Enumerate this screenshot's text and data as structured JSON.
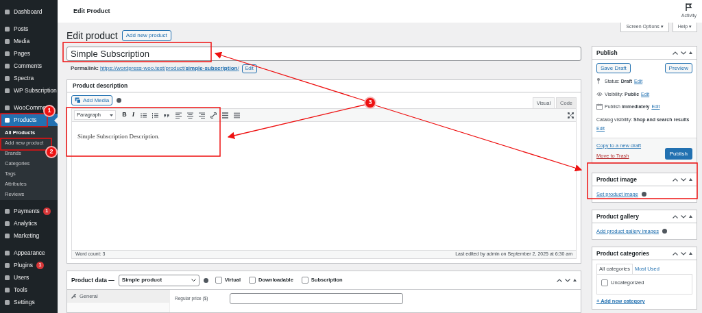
{
  "sidebar": {
    "groups": [
      {
        "items": [
          {
            "label": "Dashboard",
            "selected": false
          }
        ]
      },
      {
        "items": [
          {
            "label": "Posts",
            "selected": false
          },
          {
            "label": "Media",
            "selected": false
          },
          {
            "label": "Pages",
            "selected": false
          },
          {
            "label": "Comments",
            "selected": false
          },
          {
            "label": "Spectra",
            "selected": false
          },
          {
            "label": "WP Subscription",
            "selected": false
          }
        ]
      },
      {
        "items": [
          {
            "label": "WooCommer",
            "selected": false
          },
          {
            "label": "Products",
            "selected": true,
            "children": [
              {
                "label": "All Products",
                "selected": true
              },
              {
                "label": "Add new product",
                "selected": false
              },
              {
                "label": "Brands",
                "selected": false
              },
              {
                "label": "Categories",
                "selected": false
              },
              {
                "label": "Tags",
                "selected": false
              },
              {
                "label": "Attributes",
                "selected": false
              },
              {
                "label": "Reviews",
                "selected": false
              }
            ]
          }
        ]
      },
      {
        "items": [
          {
            "label": "Payments",
            "selected": false,
            "badge": "1"
          },
          {
            "label": "Analytics",
            "selected": false
          },
          {
            "label": "Marketing",
            "selected": false
          }
        ]
      },
      {
        "items": [
          {
            "label": "Appearance",
            "selected": false
          },
          {
            "label": "Plugins",
            "selected": false,
            "badge": "1"
          },
          {
            "label": "Users",
            "selected": false
          },
          {
            "label": "Tools",
            "selected": false
          },
          {
            "label": "Settings",
            "selected": false
          }
        ]
      }
    ]
  },
  "top_bar": {
    "title": "Edit Product",
    "activity": "Activity"
  },
  "screen_tabs": [
    "Screen Options ▾",
    "Help ▾"
  ],
  "heading": {
    "title": "Edit product",
    "button": "Add new product"
  },
  "title_field": {
    "value": "Simple Subscription"
  },
  "permalink": {
    "label": "Permalink:",
    "url": "https://wordpress-woo.test/product/**simple-subscription**/",
    "button": "Edit"
  },
  "description": {
    "title": "Product description",
    "add_media": "Add Media",
    "tabs": [
      {
        "label": "Visual",
        "selected": true
      },
      {
        "label": "Code",
        "selected": false
      }
    ],
    "format": "Paragraph",
    "bold": "B",
    "italic": "I",
    "content": "Simple Subscription Description.",
    "word_count": "Word count: 3",
    "last_edited": "Last edited by admin on September 2, 2025 at 6:30 am"
  },
  "product_data": {
    "label": "Product data —",
    "type": "Simple product",
    "options": [
      {
        "label": "Virtual",
        "checked": false
      },
      {
        "label": "Downloadable",
        "checked": false
      },
      {
        "label": "Subscription",
        "checked": false
      }
    ],
    "tabs": [
      {
        "label": "General",
        "selected": true
      }
    ],
    "fields": [
      {
        "label": "Regular price ($)"
      }
    ]
  },
  "publish": {
    "title": "Publish",
    "save_draft": "Save Draft",
    "preview": "Preview",
    "lines": [
      {
        "kind": "status",
        "text": "Status: **Draft**",
        "link": "Edit"
      },
      {
        "kind": "visibility",
        "text": "Visibility: **Public**",
        "link": "Edit"
      },
      {
        "kind": "schedule",
        "text": "Publish **immediately**",
        "link": "Edit"
      },
      {
        "kind": "catalog",
        "text": "Catalog visibility: **Shop and search results**",
        "link": "Edit"
      }
    ],
    "copy_link": "Copy to a new draft",
    "trash_link": "Move to Trash",
    "publish_button": "Publish"
  },
  "product_image": {
    "title": "Product image",
    "link": "Set product image"
  },
  "product_gallery": {
    "title": "Product gallery",
    "link": "Add product gallery images"
  },
  "product_categories": {
    "title": "Product categories",
    "tabs": [
      {
        "label": "All categories",
        "selected": true
      },
      {
        "label": "Most Used",
        "selected": false
      }
    ],
    "categories": [
      {
        "label": "Uncategorized",
        "checked": false
      }
    ],
    "add_link": "+ Add new category"
  },
  "annotations": [
    {
      "label": "1"
    },
    {
      "label": "2"
    },
    {
      "label": "3"
    }
  ]
}
